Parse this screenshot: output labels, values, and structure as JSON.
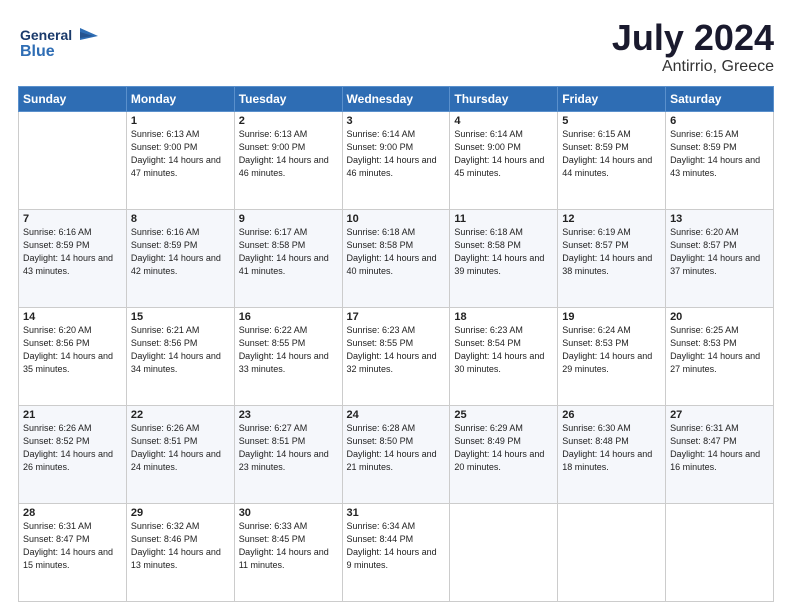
{
  "logo": {
    "general": "General",
    "blue": "Blue"
  },
  "header": {
    "title": "July 2024",
    "subtitle": "Antirrio, Greece"
  },
  "days_of_week": [
    "Sunday",
    "Monday",
    "Tuesday",
    "Wednesday",
    "Thursday",
    "Friday",
    "Saturday"
  ],
  "weeks": [
    [
      {
        "day": "",
        "sunrise": "",
        "sunset": "",
        "daylight": ""
      },
      {
        "day": "1",
        "sunrise": "Sunrise: 6:13 AM",
        "sunset": "Sunset: 9:00 PM",
        "daylight": "Daylight: 14 hours and 47 minutes."
      },
      {
        "day": "2",
        "sunrise": "Sunrise: 6:13 AM",
        "sunset": "Sunset: 9:00 PM",
        "daylight": "Daylight: 14 hours and 46 minutes."
      },
      {
        "day": "3",
        "sunrise": "Sunrise: 6:14 AM",
        "sunset": "Sunset: 9:00 PM",
        "daylight": "Daylight: 14 hours and 46 minutes."
      },
      {
        "day": "4",
        "sunrise": "Sunrise: 6:14 AM",
        "sunset": "Sunset: 9:00 PM",
        "daylight": "Daylight: 14 hours and 45 minutes."
      },
      {
        "day": "5",
        "sunrise": "Sunrise: 6:15 AM",
        "sunset": "Sunset: 8:59 PM",
        "daylight": "Daylight: 14 hours and 44 minutes."
      },
      {
        "day": "6",
        "sunrise": "Sunrise: 6:15 AM",
        "sunset": "Sunset: 8:59 PM",
        "daylight": "Daylight: 14 hours and 43 minutes."
      }
    ],
    [
      {
        "day": "7",
        "sunrise": "Sunrise: 6:16 AM",
        "sunset": "Sunset: 8:59 PM",
        "daylight": "Daylight: 14 hours and 43 minutes."
      },
      {
        "day": "8",
        "sunrise": "Sunrise: 6:16 AM",
        "sunset": "Sunset: 8:59 PM",
        "daylight": "Daylight: 14 hours and 42 minutes."
      },
      {
        "day": "9",
        "sunrise": "Sunrise: 6:17 AM",
        "sunset": "Sunset: 8:58 PM",
        "daylight": "Daylight: 14 hours and 41 minutes."
      },
      {
        "day": "10",
        "sunrise": "Sunrise: 6:18 AM",
        "sunset": "Sunset: 8:58 PM",
        "daylight": "Daylight: 14 hours and 40 minutes."
      },
      {
        "day": "11",
        "sunrise": "Sunrise: 6:18 AM",
        "sunset": "Sunset: 8:58 PM",
        "daylight": "Daylight: 14 hours and 39 minutes."
      },
      {
        "day": "12",
        "sunrise": "Sunrise: 6:19 AM",
        "sunset": "Sunset: 8:57 PM",
        "daylight": "Daylight: 14 hours and 38 minutes."
      },
      {
        "day": "13",
        "sunrise": "Sunrise: 6:20 AM",
        "sunset": "Sunset: 8:57 PM",
        "daylight": "Daylight: 14 hours and 37 minutes."
      }
    ],
    [
      {
        "day": "14",
        "sunrise": "Sunrise: 6:20 AM",
        "sunset": "Sunset: 8:56 PM",
        "daylight": "Daylight: 14 hours and 35 minutes."
      },
      {
        "day": "15",
        "sunrise": "Sunrise: 6:21 AM",
        "sunset": "Sunset: 8:56 PM",
        "daylight": "Daylight: 14 hours and 34 minutes."
      },
      {
        "day": "16",
        "sunrise": "Sunrise: 6:22 AM",
        "sunset": "Sunset: 8:55 PM",
        "daylight": "Daylight: 14 hours and 33 minutes."
      },
      {
        "day": "17",
        "sunrise": "Sunrise: 6:23 AM",
        "sunset": "Sunset: 8:55 PM",
        "daylight": "Daylight: 14 hours and 32 minutes."
      },
      {
        "day": "18",
        "sunrise": "Sunrise: 6:23 AM",
        "sunset": "Sunset: 8:54 PM",
        "daylight": "Daylight: 14 hours and 30 minutes."
      },
      {
        "day": "19",
        "sunrise": "Sunrise: 6:24 AM",
        "sunset": "Sunset: 8:53 PM",
        "daylight": "Daylight: 14 hours and 29 minutes."
      },
      {
        "day": "20",
        "sunrise": "Sunrise: 6:25 AM",
        "sunset": "Sunset: 8:53 PM",
        "daylight": "Daylight: 14 hours and 27 minutes."
      }
    ],
    [
      {
        "day": "21",
        "sunrise": "Sunrise: 6:26 AM",
        "sunset": "Sunset: 8:52 PM",
        "daylight": "Daylight: 14 hours and 26 minutes."
      },
      {
        "day": "22",
        "sunrise": "Sunrise: 6:26 AM",
        "sunset": "Sunset: 8:51 PM",
        "daylight": "Daylight: 14 hours and 24 minutes."
      },
      {
        "day": "23",
        "sunrise": "Sunrise: 6:27 AM",
        "sunset": "Sunset: 8:51 PM",
        "daylight": "Daylight: 14 hours and 23 minutes."
      },
      {
        "day": "24",
        "sunrise": "Sunrise: 6:28 AM",
        "sunset": "Sunset: 8:50 PM",
        "daylight": "Daylight: 14 hours and 21 minutes."
      },
      {
        "day": "25",
        "sunrise": "Sunrise: 6:29 AM",
        "sunset": "Sunset: 8:49 PM",
        "daylight": "Daylight: 14 hours and 20 minutes."
      },
      {
        "day": "26",
        "sunrise": "Sunrise: 6:30 AM",
        "sunset": "Sunset: 8:48 PM",
        "daylight": "Daylight: 14 hours and 18 minutes."
      },
      {
        "day": "27",
        "sunrise": "Sunrise: 6:31 AM",
        "sunset": "Sunset: 8:47 PM",
        "daylight": "Daylight: 14 hours and 16 minutes."
      }
    ],
    [
      {
        "day": "28",
        "sunrise": "Sunrise: 6:31 AM",
        "sunset": "Sunset: 8:47 PM",
        "daylight": "Daylight: 14 hours and 15 minutes."
      },
      {
        "day": "29",
        "sunrise": "Sunrise: 6:32 AM",
        "sunset": "Sunset: 8:46 PM",
        "daylight": "Daylight: 14 hours and 13 minutes."
      },
      {
        "day": "30",
        "sunrise": "Sunrise: 6:33 AM",
        "sunset": "Sunset: 8:45 PM",
        "daylight": "Daylight: 14 hours and 11 minutes."
      },
      {
        "day": "31",
        "sunrise": "Sunrise: 6:34 AM",
        "sunset": "Sunset: 8:44 PM",
        "daylight": "Daylight: 14 hours and 9 minutes."
      },
      {
        "day": "",
        "sunrise": "",
        "sunset": "",
        "daylight": ""
      },
      {
        "day": "",
        "sunrise": "",
        "sunset": "",
        "daylight": ""
      },
      {
        "day": "",
        "sunrise": "",
        "sunset": "",
        "daylight": ""
      }
    ]
  ]
}
